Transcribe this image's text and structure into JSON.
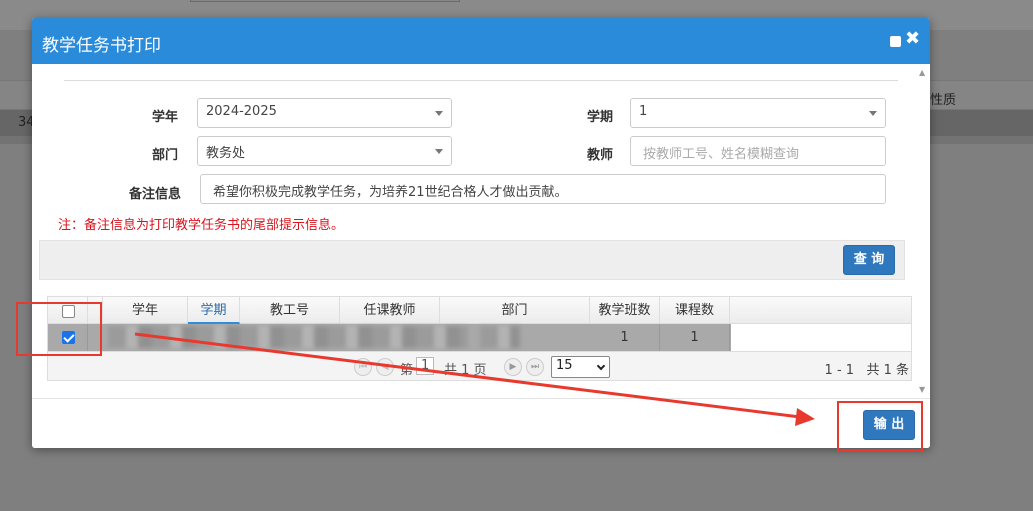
{
  "modal": {
    "title": "教学任务书打印",
    "icons": {
      "maximize": "maximize-icon",
      "close": "close-icon"
    },
    "close_glyph": "✖"
  },
  "form": {
    "year_label": "学年",
    "year_value": "2024-2025",
    "term_label": "学期",
    "term_value": "1",
    "dept_label": "部门",
    "dept_value": "教务处",
    "teacher_label": "教师",
    "teacher_placeholder": "按教师工号、姓名模糊查询",
    "remark_label": "备注信息",
    "remark_value": "希望你积极完成教学任务，为培养21世纪合格人才做出贡献。",
    "note": "注：备注信息为打印教学任务书的尾部提示信息。",
    "query_button": "查 询"
  },
  "grid": {
    "columns": [
      "学年",
      "学期",
      "教工号",
      "任课教师",
      "部门",
      "教学班数",
      "课程数"
    ],
    "rows": [
      {
        "checked": true,
        "class_count": "1",
        "course_count": "1"
      }
    ],
    "pager": {
      "page_prefix": "第",
      "page_value": "1",
      "page_suffix": "共 1 页",
      "page_size": "15",
      "range": "1 - 1",
      "total": "共 1 条"
    }
  },
  "footer": {
    "export_button": "输 出"
  },
  "background": {
    "left_text": "34",
    "right_text": "性质"
  },
  "colors": {
    "header_blue": "#2a8bdb",
    "button_blue": "#2f78bd",
    "note_red": "#d9141c",
    "annotation_red": "#e8392f"
  }
}
